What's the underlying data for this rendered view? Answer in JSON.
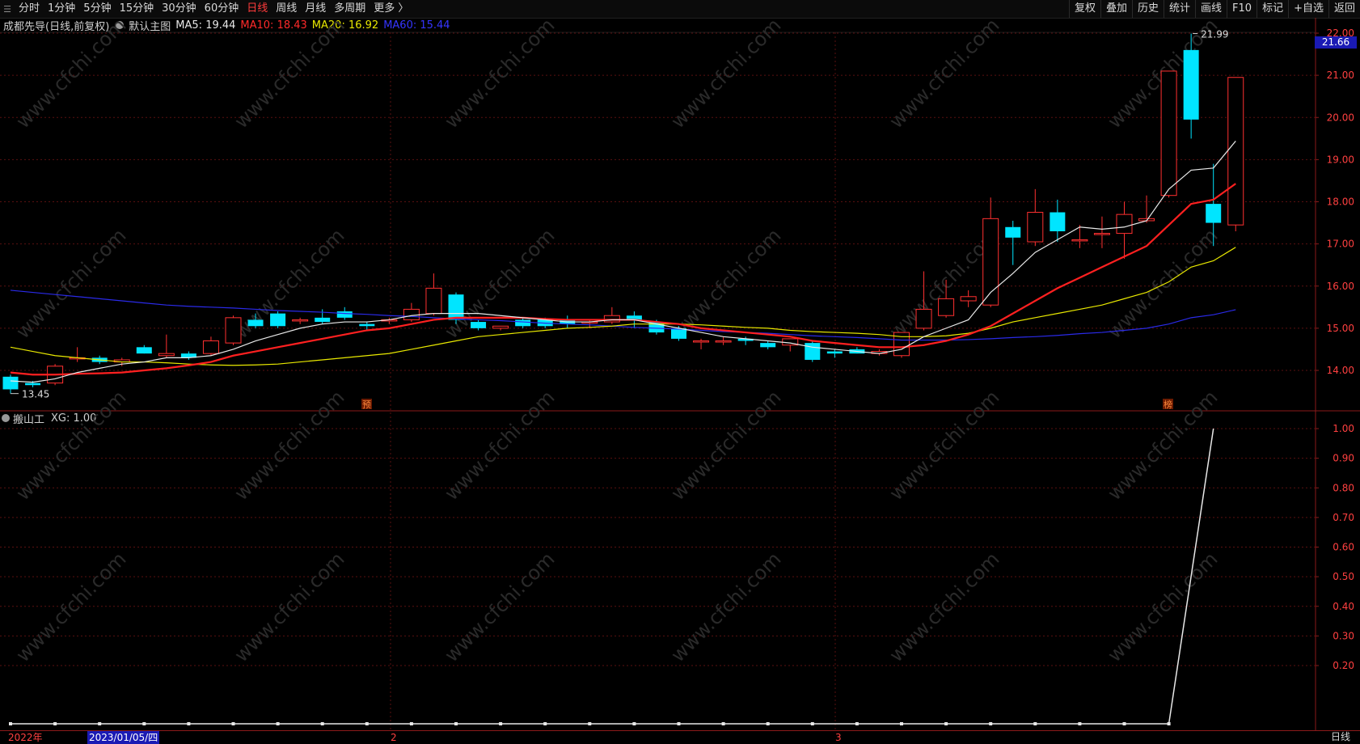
{
  "topbar": {
    "periods": [
      "分时",
      "1分钟",
      "5分钟",
      "15分钟",
      "30分钟",
      "60分钟",
      "日线",
      "周线",
      "月线",
      "多周期",
      "更多 〉"
    ],
    "active_period": "日线",
    "right_buttons": [
      "复权",
      "叠加",
      "历史",
      "统计",
      "画线",
      "F10",
      "标记",
      "+自选",
      "返回"
    ]
  },
  "main_info": {
    "stock": "成都先导(日线,前复权)",
    "template": "默认主图",
    "ma5": "MA5: 19.44",
    "ma10": "MA10: 18.43",
    "ma20": "MA20: 16.92",
    "ma60": "MA60: 15.44",
    "colors": {
      "ma5": "#e8e8e8",
      "ma10": "#ff2a2a",
      "ma20": "#e8e800",
      "ma60": "#2a2ae8"
    }
  },
  "price_axis": {
    "labels": [
      "22.00",
      "21.00",
      "20.00",
      "19.00",
      "18.00",
      "17.00",
      "16.00",
      "15.00",
      "14.00"
    ],
    "current_price": "21.66"
  },
  "annotations": {
    "high_label": "21.99",
    "low_label": "13.45",
    "marker_left": "预",
    "marker_right": "榜"
  },
  "sub_info": {
    "indicator": "搬山工",
    "value": "XG: 1.00"
  },
  "sub_axis": {
    "labels": [
      "1.00",
      "0.90",
      "0.80",
      "0.70",
      "0.60",
      "0.50",
      "0.40",
      "0.30",
      "0.20"
    ]
  },
  "time_axis": {
    "labels": [
      "2022年",
      "2023/01/05/四",
      "2",
      "3"
    ],
    "period": "日线"
  },
  "watermark": "www.cfchi.com",
  "chart_data": {
    "type": "candlestick",
    "price_range": [
      13.45,
      22.0
    ],
    "candles": [
      {
        "o": 13.85,
        "h": 13.9,
        "l": 13.45,
        "c": 13.55
      },
      {
        "o": 13.7,
        "h": 13.75,
        "l": 13.6,
        "c": 13.65
      },
      {
        "o": 13.7,
        "h": 14.15,
        "l": 13.65,
        "c": 14.1
      },
      {
        "o": 14.3,
        "h": 14.55,
        "l": 14.2,
        "c": 14.3
      },
      {
        "o": 14.3,
        "h": 14.35,
        "l": 14.15,
        "c": 14.2
      },
      {
        "o": 14.2,
        "h": 14.3,
        "l": 14.1,
        "c": 14.25
      },
      {
        "o": 14.55,
        "h": 14.6,
        "l": 14.4,
        "c": 14.4
      },
      {
        "o": 14.35,
        "h": 14.85,
        "l": 14.3,
        "c": 14.4
      },
      {
        "o": 14.4,
        "h": 14.45,
        "l": 14.25,
        "c": 14.3
      },
      {
        "o": 14.4,
        "h": 14.8,
        "l": 14.35,
        "c": 14.7
      },
      {
        "o": 14.65,
        "h": 15.3,
        "l": 14.6,
        "c": 15.25
      },
      {
        "o": 15.2,
        "h": 15.35,
        "l": 15.0,
        "c": 15.05
      },
      {
        "o": 15.35,
        "h": 15.4,
        "l": 15.0,
        "c": 15.05
      },
      {
        "o": 15.2,
        "h": 15.25,
        "l": 15.1,
        "c": 15.2
      },
      {
        "o": 15.25,
        "h": 15.45,
        "l": 15.1,
        "c": 15.15
      },
      {
        "o": 15.4,
        "h": 15.5,
        "l": 15.2,
        "c": 15.25
      },
      {
        "o": 15.1,
        "h": 15.15,
        "l": 14.95,
        "c": 15.05
      },
      {
        "o": 15.2,
        "h": 15.25,
        "l": 15.1,
        "c": 15.2
      },
      {
        "o": 15.2,
        "h": 15.6,
        "l": 15.15,
        "c": 15.45
      },
      {
        "o": 15.35,
        "h": 16.3,
        "l": 15.3,
        "c": 15.95
      },
      {
        "o": 15.8,
        "h": 15.85,
        "l": 15.1,
        "c": 15.2
      },
      {
        "o": 15.15,
        "h": 15.2,
        "l": 14.95,
        "c": 15.0
      },
      {
        "o": 15.0,
        "h": 15.05,
        "l": 14.95,
        "c": 15.05
      },
      {
        "o": 15.2,
        "h": 15.25,
        "l": 15.0,
        "c": 15.05
      },
      {
        "o": 15.2,
        "h": 15.25,
        "l": 15.0,
        "c": 15.05
      },
      {
        "o": 15.2,
        "h": 15.3,
        "l": 15.0,
        "c": 15.1
      },
      {
        "o": 15.15,
        "h": 15.2,
        "l": 15.0,
        "c": 15.15
      },
      {
        "o": 15.15,
        "h": 15.5,
        "l": 15.1,
        "c": 15.3
      },
      {
        "o": 15.3,
        "h": 15.4,
        "l": 15.0,
        "c": 15.2
      },
      {
        "o": 15.15,
        "h": 15.2,
        "l": 14.85,
        "c": 14.9
      },
      {
        "o": 15.0,
        "h": 15.05,
        "l": 14.7,
        "c": 14.75
      },
      {
        "o": 14.7,
        "h": 14.75,
        "l": 14.5,
        "c": 14.7
      },
      {
        "o": 14.7,
        "h": 14.8,
        "l": 14.6,
        "c": 14.7
      },
      {
        "o": 14.75,
        "h": 14.8,
        "l": 14.6,
        "c": 14.7
      },
      {
        "o": 14.65,
        "h": 14.7,
        "l": 14.5,
        "c": 14.55
      },
      {
        "o": 14.6,
        "h": 14.75,
        "l": 14.45,
        "c": 14.75
      },
      {
        "o": 14.65,
        "h": 14.7,
        "l": 14.2,
        "c": 14.25
      },
      {
        "o": 14.45,
        "h": 14.5,
        "l": 14.3,
        "c": 14.4
      },
      {
        "o": 14.5,
        "h": 14.55,
        "l": 14.4,
        "c": 14.4
      },
      {
        "o": 14.4,
        "h": 14.5,
        "l": 14.35,
        "c": 14.45
      },
      {
        "o": 14.35,
        "h": 14.9,
        "l": 14.3,
        "c": 14.9
      },
      {
        "o": 15.0,
        "h": 16.35,
        "l": 14.95,
        "c": 15.45
      },
      {
        "o": 15.3,
        "h": 16.15,
        "l": 15.25,
        "c": 15.7
      },
      {
        "o": 15.65,
        "h": 15.9,
        "l": 15.5,
        "c": 15.75
      },
      {
        "o": 15.55,
        "h": 18.1,
        "l": 15.5,
        "c": 17.6
      },
      {
        "o": 17.4,
        "h": 17.55,
        "l": 16.5,
        "c": 17.15
      },
      {
        "o": 17.05,
        "h": 18.3,
        "l": 16.95,
        "c": 17.75
      },
      {
        "o": 17.75,
        "h": 18.05,
        "l": 17.05,
        "c": 17.3
      },
      {
        "o": 17.1,
        "h": 17.45,
        "l": 16.9,
        "c": 17.1
      },
      {
        "o": 17.25,
        "h": 17.65,
        "l": 16.9,
        "c": 17.25
      },
      {
        "o": 17.25,
        "h": 18.0,
        "l": 16.65,
        "c": 17.7
      },
      {
        "o": 17.55,
        "h": 18.15,
        "l": 17.5,
        "c": 17.6
      },
      {
        "o": 18.15,
        "h": 21.1,
        "l": 18.1,
        "c": 21.1
      },
      {
        "o": 21.6,
        "h": 21.99,
        "l": 19.5,
        "c": 19.95
      },
      {
        "o": 17.95,
        "h": 18.9,
        "l": 16.95,
        "c": 17.5
      },
      {
        "o": 17.45,
        "h": 20.95,
        "l": 17.3,
        "c": 20.95
      }
    ],
    "ma5": [
      13.75,
      13.72,
      13.8,
      13.95,
      14.05,
      14.15,
      14.2,
      14.3,
      14.3,
      14.35,
      14.5,
      14.7,
      14.85,
      15.0,
      15.1,
      15.15,
      15.15,
      15.2,
      15.3,
      15.35,
      15.35,
      15.35,
      15.3,
      15.25,
      15.2,
      15.15,
      15.15,
      15.2,
      15.2,
      15.1,
      15.0,
      14.9,
      14.8,
      14.75,
      14.7,
      14.65,
      14.55,
      14.5,
      14.45,
      14.4,
      14.5,
      14.8,
      15.0,
      15.2,
      15.85,
      16.3,
      16.8,
      17.1,
      17.4,
      17.35,
      17.4,
      17.55,
      18.3,
      18.75,
      18.8,
      19.44
    ],
    "ma10": [
      13.95,
      13.9,
      13.9,
      13.92,
      13.93,
      13.95,
      14.0,
      14.05,
      14.12,
      14.2,
      14.35,
      14.45,
      14.55,
      14.65,
      14.75,
      14.85,
      14.95,
      15.0,
      15.1,
      15.2,
      15.25,
      15.25,
      15.25,
      15.25,
      15.22,
      15.2,
      15.2,
      15.2,
      15.2,
      15.15,
      15.1,
      15.0,
      14.95,
      14.9,
      14.85,
      14.8,
      14.7,
      14.65,
      14.6,
      14.55,
      14.55,
      14.6,
      14.7,
      14.85,
      15.05,
      15.35,
      15.65,
      15.95,
      16.2,
      16.45,
      16.7,
      16.95,
      17.45,
      17.95,
      18.05,
      18.43
    ],
    "ma20": [
      14.55,
      14.45,
      14.35,
      14.3,
      14.25,
      14.2,
      14.2,
      14.18,
      14.15,
      14.13,
      14.12,
      14.13,
      14.15,
      14.2,
      14.25,
      14.3,
      14.35,
      14.4,
      14.5,
      14.6,
      14.7,
      14.8,
      14.85,
      14.9,
      14.95,
      15.0,
      15.02,
      15.05,
      15.1,
      15.1,
      15.1,
      15.08,
      15.05,
      15.02,
      15.0,
      14.95,
      14.92,
      14.9,
      14.88,
      14.85,
      14.8,
      14.8,
      14.82,
      14.88,
      15.0,
      15.15,
      15.25,
      15.35,
      15.45,
      15.55,
      15.7,
      15.85,
      16.1,
      16.45,
      16.6,
      16.92
    ],
    "ma60": [
      15.9,
      15.85,
      15.8,
      15.75,
      15.7,
      15.65,
      15.6,
      15.55,
      15.52,
      15.5,
      15.48,
      15.45,
      15.42,
      15.4,
      15.38,
      15.35,
      15.33,
      15.3,
      15.28,
      15.25,
      15.22,
      15.2,
      15.18,
      15.15,
      15.12,
      15.1,
      15.08,
      15.05,
      15.02,
      15.0,
      14.98,
      14.95,
      14.92,
      14.9,
      14.88,
      14.85,
      14.82,
      14.8,
      14.78,
      14.75,
      14.72,
      14.72,
      14.72,
      14.73,
      14.75,
      14.78,
      14.8,
      14.83,
      14.87,
      14.9,
      14.95,
      15.0,
      15.1,
      15.25,
      15.32,
      15.44
    ],
    "indicator": {
      "name": "XG",
      "values": [
        0,
        0,
        0,
        0,
        0,
        0,
        0,
        0,
        0,
        0,
        0,
        0,
        0,
        0,
        0,
        0,
        0,
        0,
        0,
        0,
        0,
        0,
        0,
        0,
        0,
        0,
        0,
        1
      ]
    }
  }
}
